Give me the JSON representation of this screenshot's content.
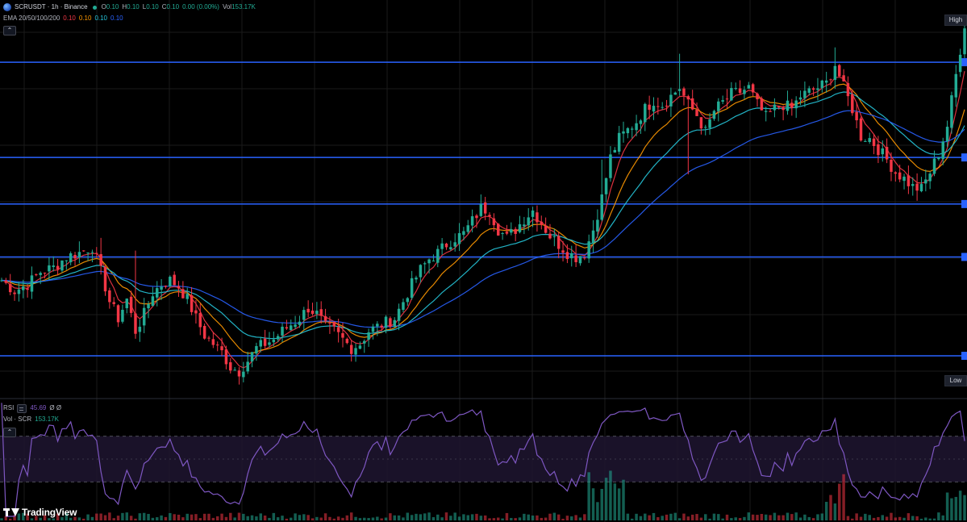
{
  "legend": {
    "symbol": "SCRUSDT · 1h · Binance",
    "ohlc": [
      {
        "k": "O",
        "v": "0.10"
      },
      {
        "k": "H",
        "v": "0.10"
      },
      {
        "k": "L",
        "v": "0.10"
      },
      {
        "k": "C",
        "v": "0.10"
      }
    ],
    "change": "0.00 (0.00%)",
    "vol_label": "Vol",
    "vol_value": "153.17K"
  },
  "ema_legend": {
    "label": "EMA 20/50/100/200",
    "values": [
      "0.10",
      "0.10",
      "0.10",
      "0.10"
    ]
  },
  "rsi_legend": {
    "label": "RSI",
    "value": "45.69",
    "extra": "Ø Ø"
  },
  "vol_legend": {
    "label": "Vol · SCR",
    "value": "153.17K"
  },
  "badges": {
    "high": "High",
    "low": "Low"
  },
  "brand": {
    "name": "TradingView"
  },
  "colors": {
    "background": "#000000",
    "grid": "#1a1a1a",
    "up": "#22ab94",
    "down": "#f23645",
    "ema20": "#f23645",
    "ema50": "#ff9800",
    "ema100": "#26c6da",
    "ema200": "#2962ff",
    "hline": "#2962ff",
    "rsi": "#7e57c2",
    "rsi_band": "#1e1530"
  },
  "chart_data": {
    "type": "candlestick",
    "symbol": "SCRUSDT",
    "interval": "1h",
    "exchange": "Binance",
    "indicators": [
      "EMA 20",
      "EMA 50",
      "EMA 100",
      "EMA 200",
      "RSI",
      "Volume"
    ],
    "grid": true,
    "price_axis_visible": false,
    "horizontal_levels_count": 5,
    "close_path": [
      [
        0,
        0.46
      ],
      [
        3,
        0.41
      ],
      [
        6,
        0.44
      ],
      [
        9,
        0.5
      ],
      [
        12,
        0.52
      ],
      [
        15,
        0.57
      ],
      [
        18,
        0.59
      ],
      [
        21,
        0.62
      ],
      [
        23,
        0.5
      ],
      [
        25,
        0.36
      ],
      [
        27,
        0.28
      ],
      [
        29,
        0.37
      ],
      [
        31,
        0.22
      ],
      [
        33,
        0.3
      ],
      [
        35,
        0.4
      ],
      [
        37,
        0.44
      ],
      [
        39,
        0.46
      ],
      [
        41,
        0.43
      ],
      [
        43,
        0.37
      ],
      [
        45,
        0.28
      ],
      [
        47,
        0.2
      ],
      [
        49,
        0.16
      ],
      [
        51,
        0.12
      ],
      [
        53,
        0.05
      ],
      [
        55,
        0.03
      ],
      [
        57,
        0.08
      ],
      [
        59,
        0.14
      ],
      [
        61,
        0.16
      ],
      [
        63,
        0.18
      ],
      [
        65,
        0.22
      ],
      [
        67,
        0.25
      ],
      [
        69,
        0.28
      ],
      [
        71,
        0.33
      ],
      [
        73,
        0.3
      ],
      [
        75,
        0.24
      ],
      [
        77,
        0.22
      ],
      [
        79,
        0.18
      ],
      [
        81,
        0.14
      ],
      [
        83,
        0.16
      ],
      [
        85,
        0.22
      ],
      [
        87,
        0.24
      ],
      [
        89,
        0.26
      ],
      [
        91,
        0.28
      ],
      [
        93,
        0.36
      ],
      [
        95,
        0.44
      ],
      [
        97,
        0.51
      ],
      [
        99,
        0.56
      ],
      [
        101,
        0.59
      ],
      [
        103,
        0.63
      ],
      [
        105,
        0.66
      ],
      [
        107,
        0.68
      ],
      [
        109,
        0.74
      ],
      [
        111,
        0.8
      ],
      [
        113,
        0.79
      ],
      [
        115,
        0.7
      ],
      [
        117,
        0.66
      ],
      [
        119,
        0.7
      ],
      [
        121,
        0.75
      ],
      [
        123,
        0.79
      ],
      [
        125,
        0.73
      ],
      [
        127,
        0.67
      ],
      [
        129,
        0.63
      ],
      [
        131,
        0.59
      ],
      [
        133,
        0.57
      ],
      [
        135,
        0.59
      ],
      [
        137,
        0.7
      ],
      [
        139,
        0.85
      ],
      [
        141,
        1.04
      ],
      [
        143,
        1.13
      ],
      [
        145,
        1.17
      ],
      [
        147,
        1.21
      ],
      [
        149,
        1.27
      ],
      [
        151,
        1.31
      ],
      [
        153,
        1.29
      ],
      [
        155,
        1.33
      ],
      [
        157,
        1.37
      ],
      [
        159,
        1.29
      ],
      [
        161,
        1.24
      ],
      [
        163,
        1.16
      ],
      [
        165,
        1.26
      ],
      [
        167,
        1.3
      ],
      [
        169,
        1.34
      ],
      [
        171,
        1.35
      ],
      [
        173,
        1.37
      ],
      [
        175,
        1.29
      ],
      [
        177,
        1.23
      ],
      [
        179,
        1.27
      ],
      [
        181,
        1.29
      ],
      [
        183,
        1.27
      ],
      [
        185,
        1.33
      ],
      [
        187,
        1.35
      ],
      [
        189,
        1.37
      ],
      [
        191,
        1.39
      ],
      [
        193,
        1.48
      ],
      [
        195,
        1.37
      ],
      [
        197,
        1.27
      ],
      [
        199,
        1.14
      ],
      [
        201,
        1.13
      ],
      [
        203,
        1.08
      ],
      [
        205,
        1.03
      ],
      [
        207,
        0.97
      ],
      [
        209,
        0.94
      ],
      [
        211,
        0.9
      ],
      [
        213,
        0.89
      ],
      [
        215,
        0.97
      ],
      [
        217,
        1.06
      ],
      [
        219,
        1.19
      ],
      [
        221,
        1.43
      ],
      [
        223,
        1.67
      ]
    ],
    "highlight_wicks": [
      {
        "i": 23,
        "high": 0.66
      },
      {
        "i": 31,
        "high": 0.6
      },
      {
        "i": 139,
        "high": 1.03
      },
      {
        "i": 157,
        "high": 1.53
      },
      {
        "i": 159,
        "low": 0.96
      },
      {
        "i": 193,
        "high": 1.56
      },
      {
        "i": 193,
        "high": 1.54
      },
      {
        "i": 223,
        "high": 1.7
      }
    ],
    "levels": [
      1.49,
      1.04,
      0.82,
      0.57
    ],
    "rsi": {
      "overbought": 70,
      "oversold": 30,
      "last": 45.69
    },
    "volume_last": "153.17K",
    "price_range": [
      0,
      1.7
    ]
  }
}
